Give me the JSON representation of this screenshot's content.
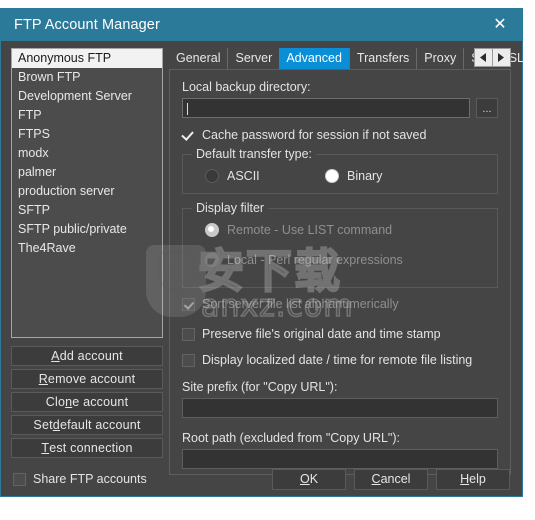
{
  "window": {
    "title": "FTP Account Manager",
    "close_icon": "close-icon",
    "accent_color": "#2b7a99",
    "tab_active_color": "#0a8fd6"
  },
  "accounts": {
    "items": [
      "Anonymous FTP",
      "Brown FTP",
      "Development Server",
      "FTP",
      "FTPS",
      "modx",
      "palmer",
      "production server",
      "SFTP",
      "SFTP public/private",
      "The4Rave"
    ],
    "selected_index": 0
  },
  "side_buttons": [
    {
      "pre": "",
      "mnemonic": "A",
      "post": "dd account"
    },
    {
      "pre": "",
      "mnemonic": "R",
      "post": "emove account"
    },
    {
      "pre": "Clo",
      "mnemonic": "n",
      "post": "e account"
    },
    {
      "pre": "Set ",
      "mnemonic": "d",
      "post": "efault account"
    },
    {
      "pre": "",
      "mnemonic": "T",
      "post": "est connection"
    }
  ],
  "tabs": {
    "items": [
      "General",
      "Server",
      "Advanced",
      "Transfers",
      "Proxy",
      "SSH/SSL"
    ],
    "active": "Advanced",
    "scroll_left_icon": "triangle-left-icon",
    "scroll_right_icon": "triangle-right-icon"
  },
  "advanced": {
    "local_backup_label": "Local backup directory:",
    "local_backup_value": "",
    "local_backup_placeholder": "",
    "browse_label": "...",
    "cache_password_label": "Cache password for session if not saved",
    "cache_password_checked": true,
    "transfer_type_group": "Default transfer type:",
    "transfer_type_options": [
      "ASCII",
      "Binary"
    ],
    "transfer_type_selected": "Binary",
    "display_filter_group": "Display filter",
    "display_filter_options": [
      "Remote - Use LIST command",
      "Local - Perl regular expressions"
    ],
    "display_filter_selected": "Remote - Use LIST command",
    "sort_label": "Sort server file list alphanumerically",
    "sort_checked": true,
    "preserve_label": "Preserve file's original date and time stamp",
    "preserve_checked": false,
    "localized_label": "Display localized date / time for remote file listing",
    "localized_checked": false,
    "site_prefix_label": "Site prefix (for \"Copy URL\"):",
    "site_prefix_value": "",
    "root_path_label": "Root path (excluded from \"Copy URL\"):",
    "root_path_value": ""
  },
  "footer": {
    "share_label": "Share FTP accounts",
    "share_checked": false,
    "buttons": [
      {
        "pre": "",
        "mnemonic": "O",
        "post": "K"
      },
      {
        "pre": "",
        "mnemonic": "C",
        "post": "ancel"
      },
      {
        "pre": "",
        "mnemonic": "H",
        "post": "elp"
      }
    ]
  },
  "watermark": {
    "main": "安下载",
    "sub": "anxz.com",
    "shield_glyph": "安"
  }
}
